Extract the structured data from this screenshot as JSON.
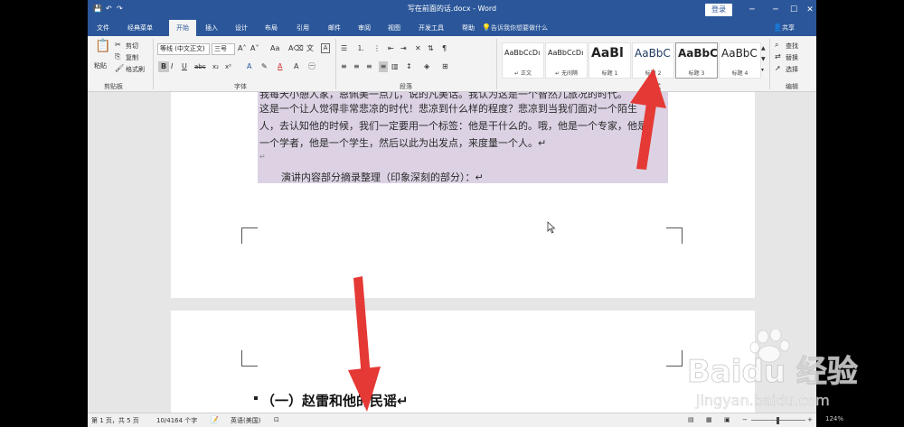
{
  "window": {
    "title": "写在前面的话.docx  -  Word",
    "login_label": "登录",
    "controls": [
      "?",
      "─",
      "☐",
      "✕"
    ]
  },
  "tabs": [
    "文件",
    "经典菜单",
    "开始",
    "插入",
    "设计",
    "布局",
    "引用",
    "邮件",
    "审阅",
    "视图",
    "开发工具",
    "帮助"
  ],
  "active_tab": "开始",
  "tellme_placeholder": "告诉我你想要做什么",
  "share_label": "共享",
  "ribbon": {
    "clipboard": {
      "paste": "粘贴",
      "cut": "剪切",
      "copy": "复制",
      "format_painter": "格式刷",
      "label": "剪贴板"
    },
    "font": {
      "name": "等线 (中文正文)",
      "size": "三号",
      "label": "字体"
    },
    "paragraph": {
      "label": "段落"
    },
    "styles": {
      "label": "样式",
      "items": [
        {
          "sample": "AaBbCcDı",
          "caption": "↵ 正文"
        },
        {
          "sample": "AaBbCcDı",
          "caption": "↵ 无间隔"
        },
        {
          "sample": "AaBl",
          "caption": "标题 1"
        },
        {
          "sample": "AaBbC",
          "caption": "标题 2"
        },
        {
          "sample": "AaBbC",
          "caption": "标题 3"
        },
        {
          "sample": "AaBbC",
          "caption": "标题 4"
        }
      ]
    },
    "editing": {
      "find": "查找",
      "replace": "替换",
      "select": "选择",
      "label": "编辑"
    }
  },
  "document": {
    "lines": [
      "我每天小憩人家，恩佩美一点儿，说的凡美话。我认为这是一个智然几旅况的时代。",
      "这是一个让人觉得非常悲凉的时代！悲凉到什么样的程度？悲凉到当我们面对一个陌生",
      "人，去认知他的时候，我们一定要用一个标签：他是干什么的。哦，他是一个专家，他是",
      "一个学者，他是一个学生，然后以此为出发点，来度量一个人。↵",
      "↵",
      "演讲内容部分摘录整理（印象深刻的部分）：↵"
    ],
    "heading": "（一）赵雷和他的民谣↵"
  },
  "statusbar": {
    "page": "第 1 页，共 5 页",
    "words": "10/4164 个字",
    "language": "英语(美国)",
    "zoom": "124%"
  },
  "watermark": {
    "brand": "Baidu 经验",
    "url": "jingyan.baidu.com"
  },
  "colors": {
    "word_blue": "#2b579a",
    "arrow_red": "#e53935",
    "highlight": "#dcd2e4"
  }
}
